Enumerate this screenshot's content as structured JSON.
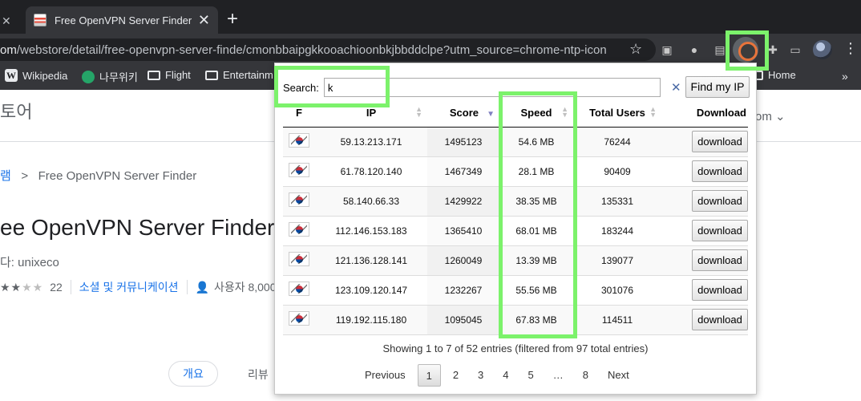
{
  "browser": {
    "tabs": [
      {
        "title": "Free OpenVPN Server Finder - Chrome Web Store",
        "active": true
      }
    ],
    "new_tab_label": "+",
    "url_domain": "om",
    "url_path": "/webstore/detail/free-openvpn-server-finde/cmonbbaipgkkooachioonbkjbbddclpe?utm_source=chrome-ntp-icon",
    "bookmarks": [
      {
        "label": "Wikipedia",
        "icon": "wikipedia-icon"
      },
      {
        "label": "나무위키",
        "icon": "namuwiki-icon"
      },
      {
        "label": "Flight",
        "icon": "folder-icon"
      },
      {
        "label": "Entertainm",
        "icon": "folder-icon"
      },
      {
        "label": "Home",
        "icon": "folder-icon"
      }
    ],
    "bookmarks_overflow": "»"
  },
  "store_page": {
    "header_title": "토어",
    "header_right": "om ⌄",
    "breadcrumb_parent": "램",
    "breadcrumb_sep": ">",
    "breadcrumb_current": "Free OpenVPN Server Finder",
    "app_title": "ee OpenVPN Server Finder",
    "publisher": "다: unixeco",
    "rating_count": "22",
    "category": "소셜 및 커뮤니케이션",
    "users": "사용자 8,000",
    "tab_overview": "개요",
    "tab_reviews": "리뷰"
  },
  "popup": {
    "search_label": "Search:",
    "search_value": "k",
    "clear_label": "✕",
    "find_ip_label": "Find my IP",
    "columns": [
      "F",
      "IP",
      "Score",
      "Speed",
      "Total Users",
      "Download"
    ],
    "rows": [
      {
        "ip": "59.13.213.171",
        "score": "1495123",
        "speed": "54.6 MB",
        "users": "76244",
        "action": "download"
      },
      {
        "ip": "61.78.120.140",
        "score": "1467349",
        "speed": "28.1 MB",
        "users": "90409",
        "action": "download"
      },
      {
        "ip": "58.140.66.33",
        "score": "1429922",
        "speed": "38.35 MB",
        "users": "135331",
        "action": "download"
      },
      {
        "ip": "112.146.153.183",
        "score": "1365410",
        "speed": "68.01 MB",
        "users": "183244",
        "action": "download"
      },
      {
        "ip": "121.136.128.141",
        "score": "1260049",
        "speed": "13.39 MB",
        "users": "139077",
        "action": "download"
      },
      {
        "ip": "123.109.120.147",
        "score": "1232267",
        "speed": "55.56 MB",
        "users": "301076",
        "action": "download"
      },
      {
        "ip": "119.192.115.180",
        "score": "1095045",
        "speed": "67.83 MB",
        "users": "114511",
        "action": "download"
      }
    ],
    "info_text": "Showing 1 to 7 of 52 entries (filtered from 97 total entries)",
    "pagination": {
      "previous": "Previous",
      "pages": [
        "1",
        "2",
        "3",
        "4",
        "5",
        "…",
        "8"
      ],
      "next": "Next",
      "current": "1"
    }
  },
  "colors": {
    "highlight": "#7cf26b",
    "link_blue": "#1a73e8",
    "chrome_dark": "#202124"
  }
}
